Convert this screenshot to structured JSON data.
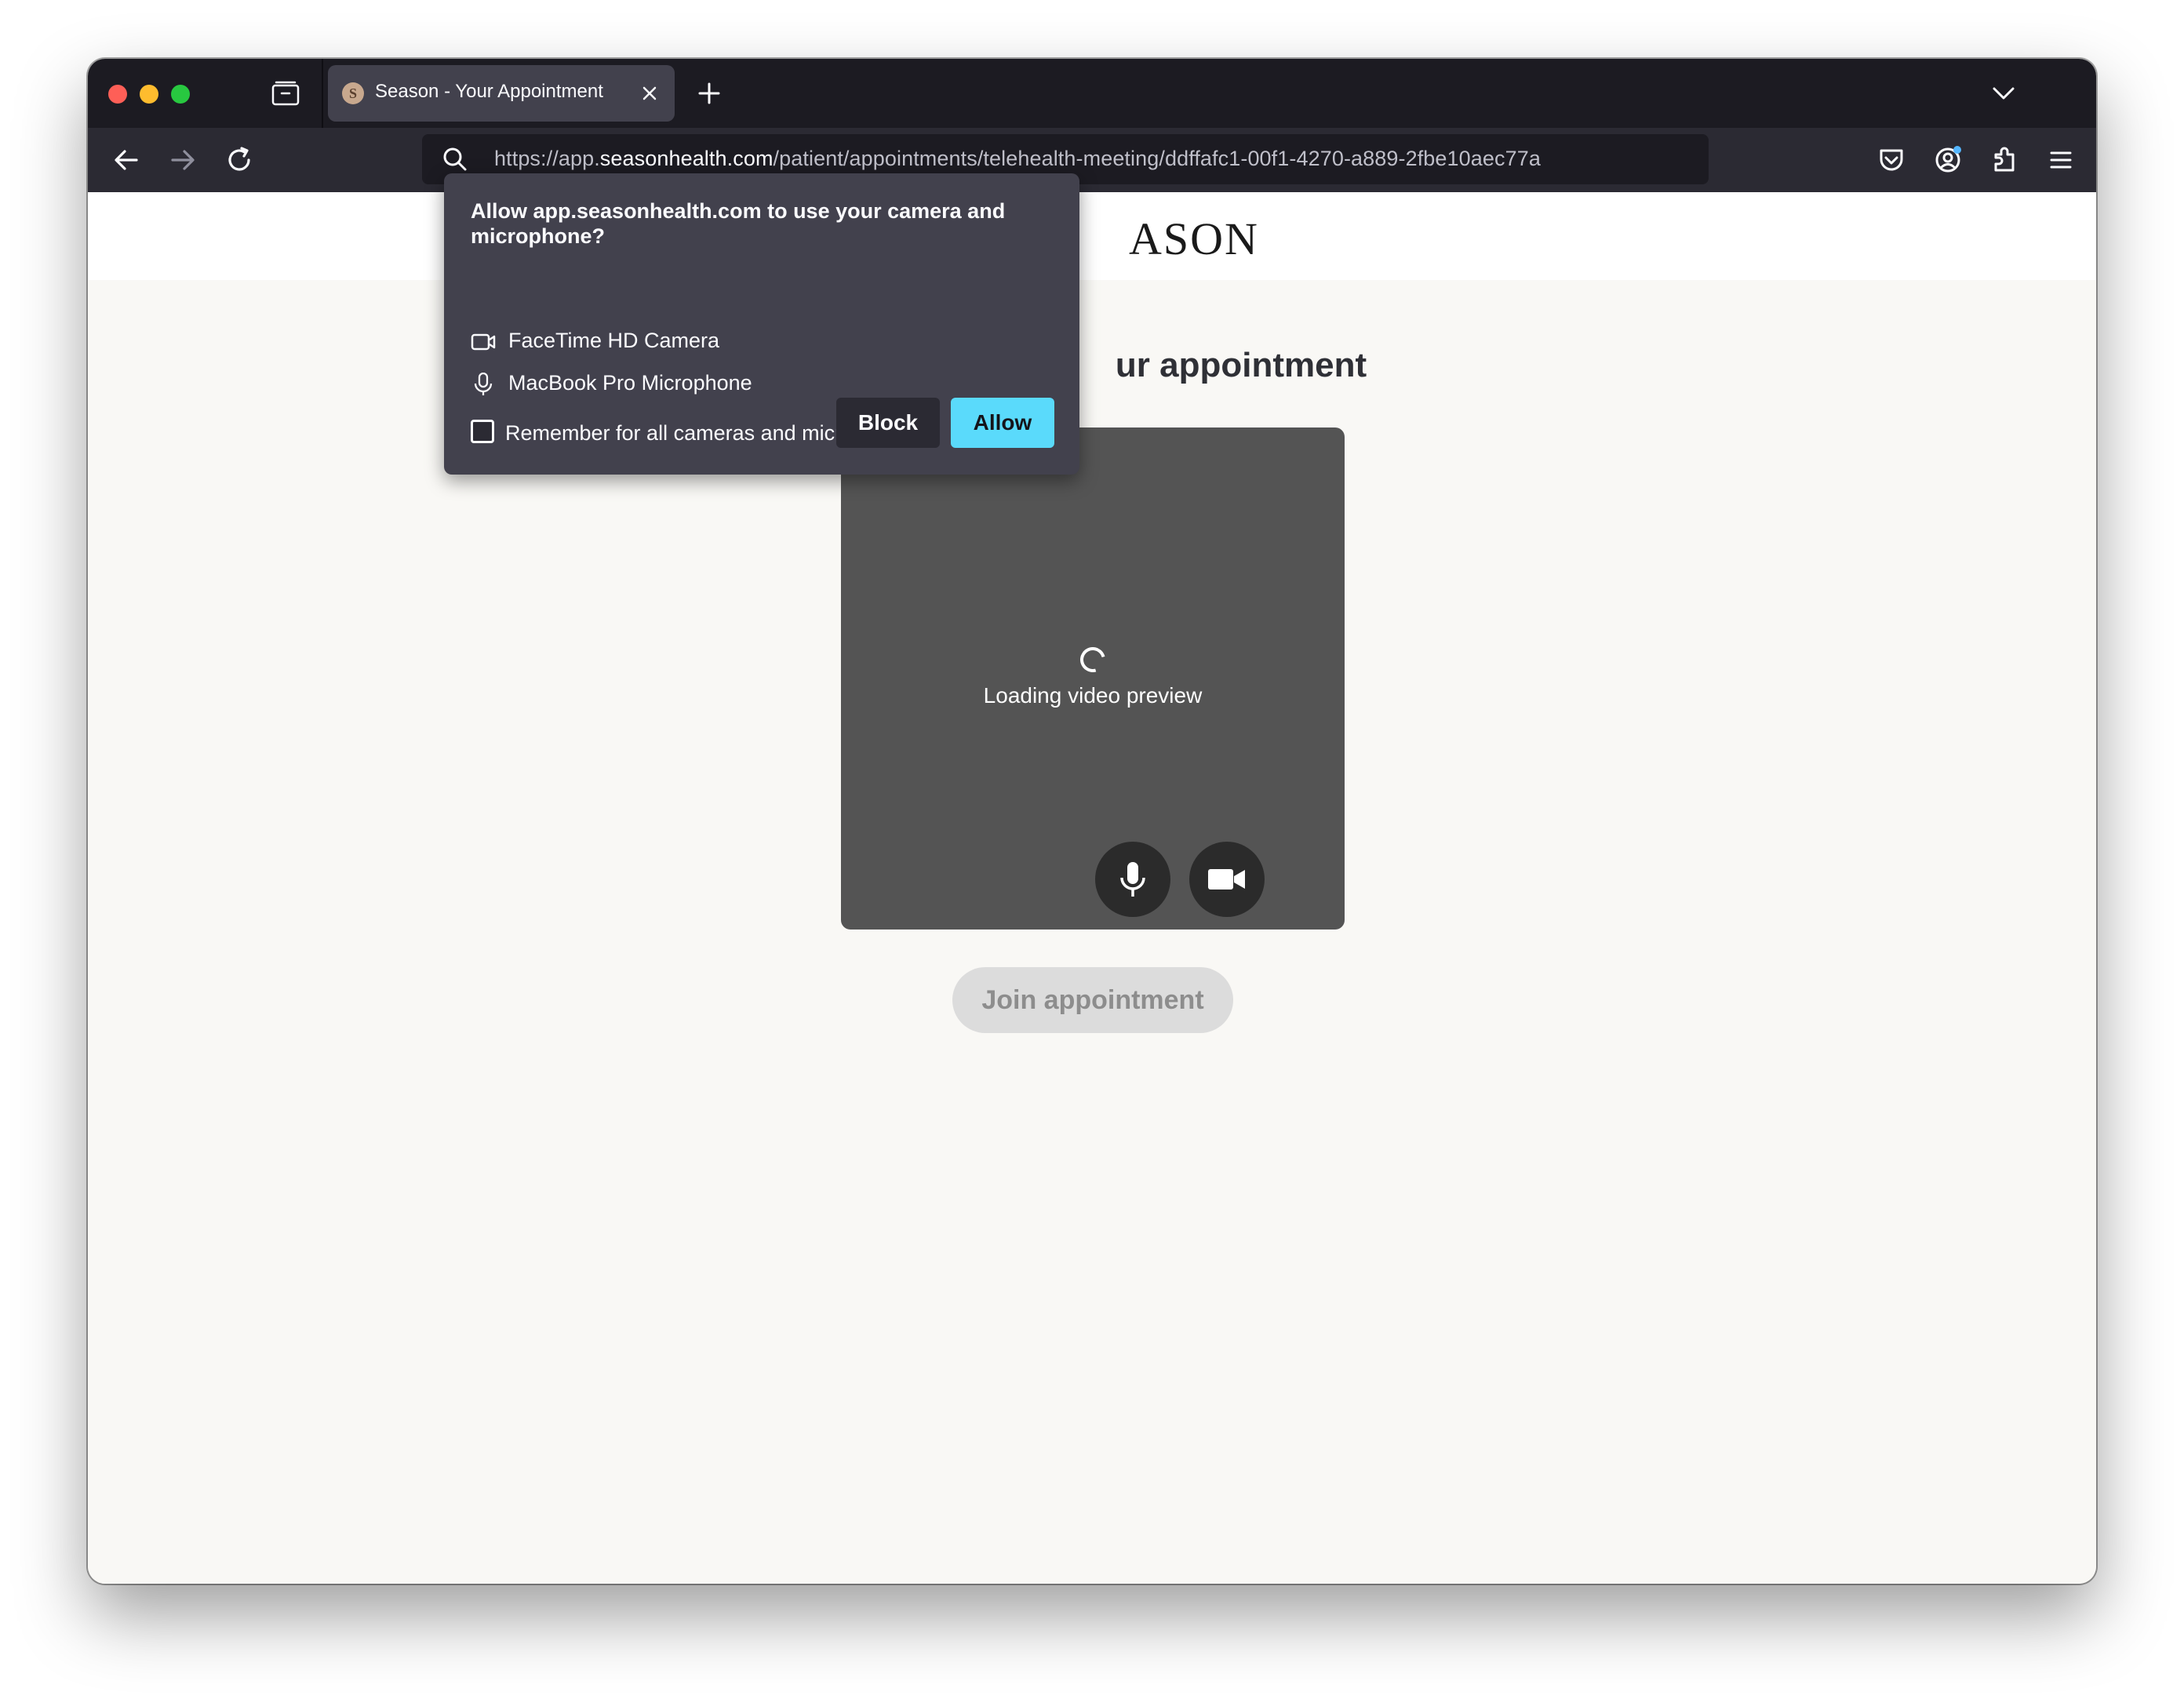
{
  "browser": {
    "tab_title": "Season - Your Appointment",
    "tab_favicon_letter": "S",
    "url_prefix": "https://app.",
    "url_host": "seasonhealth.com",
    "url_path": "/patient/appointments/telehealth-meeting/ddffafc1-00f1-4270-a889-2fbe10aec77a"
  },
  "page": {
    "logo_visible": "ASON",
    "heading_visible": "ur appointment",
    "loading_text": "Loading video preview",
    "join_button": "Join appointment"
  },
  "permission_popup": {
    "title": "Allow app.seasonhealth.com to use your camera and microphone?",
    "camera": "FaceTime HD Camera",
    "microphone": "MacBook Pro Microphone",
    "remember_label": "Remember for all cameras and microphones",
    "remember_checked": false,
    "block_label": "Block",
    "allow_label": "Allow"
  },
  "colors": {
    "allow_button": "#5adafb",
    "popup_bg": "#42414d",
    "video_box": "#545454",
    "join_disabled": "#dcdcdc"
  }
}
